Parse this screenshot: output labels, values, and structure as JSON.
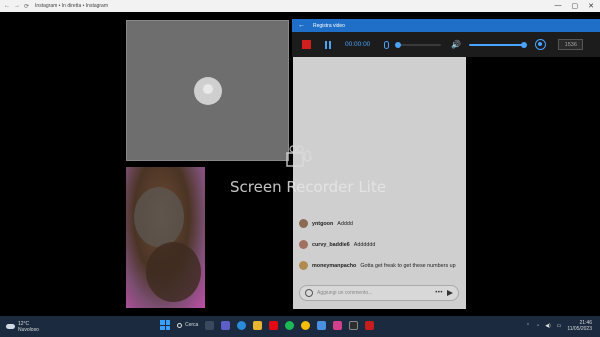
{
  "browser": {
    "tab_title": "Instagram • In diretta • Instagram",
    "nav_back": "←",
    "nav_forward": "→",
    "nav_reload": "⟳",
    "win_min": "—",
    "win_max": "▢",
    "win_close": "✕"
  },
  "recorder": {
    "back_glyph": "←",
    "header_title": "Registra video",
    "timer": "00:00:00",
    "speaker_glyph": "🔊",
    "resolution": "1536",
    "watermark": "Screen Recorder Lite",
    "accent_color": "#1f6fc8",
    "stop_color": "#d11e1e"
  },
  "comments": [
    {
      "user": "yntgoon",
      "text": "Adddd"
    },
    {
      "user": "curvy_baddie6",
      "text": "Adddddd"
    },
    {
      "user": "moneymanpacho",
      "text": "Gotta get freak to get these numbers up"
    }
  ],
  "comment_input": {
    "placeholder": "Aggiungi un commento...",
    "more_glyph": "•••"
  },
  "taskbar": {
    "temperature": "12°C",
    "weather_desc": "Nuvoloso",
    "search_label": "Cerca",
    "time": "21:46",
    "date": "11/05/2023",
    "tray_up_glyph": "⌃",
    "tray_wifi_glyph": "◔",
    "tray_volume_glyph": "◀)",
    "tray_battery_glyph": "▭"
  }
}
